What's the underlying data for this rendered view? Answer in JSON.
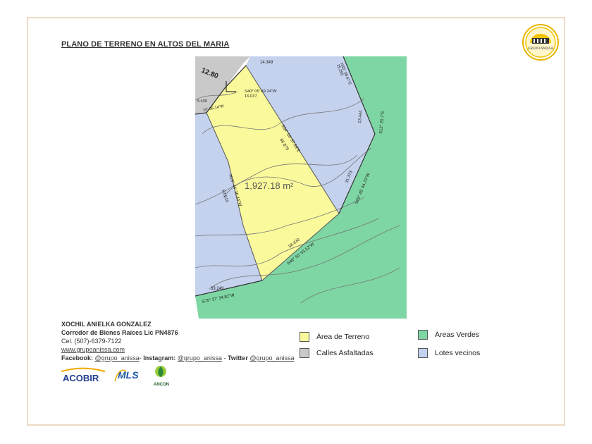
{
  "title": "PLANO DE TERRENO EN ALTOS DEL MARIA",
  "logo_text": "GRUPO ANISSA",
  "map": {
    "area_label": "1,927.18  m²",
    "labels": {
      "corner_dim": "12.80",
      "top_dist": "14.349",
      "top_right_bearing": "N35° 38.67\"E",
      "top_right_dist": "25.299",
      "left_top_dist": "5.435",
      "left_top_bearing": "07' 06.14\"W",
      "inner_bearing": "S40° 05' 49.24\"W",
      "inner_dist": "16.037",
      "diag_bearing": "S34° 09' 57.59\"E",
      "diag_dist": "66.879",
      "right_dist": "31.373",
      "right_bearing": "S25° 45' 44.70\"W",
      "far_right_dist": "13.444",
      "far_right_bearing": "S12° 20.7\"E",
      "left_bearing": "N19° 44' 36.44\"W",
      "left_dist": "63.615",
      "bottom_dist": "38.430",
      "bottom_bearing": "S46° 50' 53.12\"W",
      "low_dist": "33.249",
      "low_bearing": "S75° 37' 34.82\"W"
    }
  },
  "contact": {
    "name": "XOCHIL ANIELKA GONZALEZ",
    "role": "Corredor de Bienes Raíces Lic PN4876",
    "phone": "Cel. (507)-6379-7122",
    "website": "www.grupoanissa.com",
    "facebook_label": "Facebook:",
    "facebook": "@grupo_anissa",
    "instagram_label": "Instagram:",
    "instagram": "@grupo_anissa",
    "twitter_label": "Twitter",
    "twitter": "@grupo_anissa",
    "sep1": "-",
    "sep2": "-"
  },
  "brands": {
    "acobir": "ACOBIR",
    "mls": "MLS",
    "ancon": "ANCON"
  },
  "legend": [
    {
      "label": "Área de Terreno",
      "color": "#fafa9c"
    },
    {
      "label": "Calles Asfaltadas",
      "color": "#c9c9c9"
    },
    {
      "label": "Áreas Verdes",
      "color": "#7ed6a4"
    },
    {
      "label": "Lotes vecinos",
      "color": "#c5d2ee"
    }
  ]
}
